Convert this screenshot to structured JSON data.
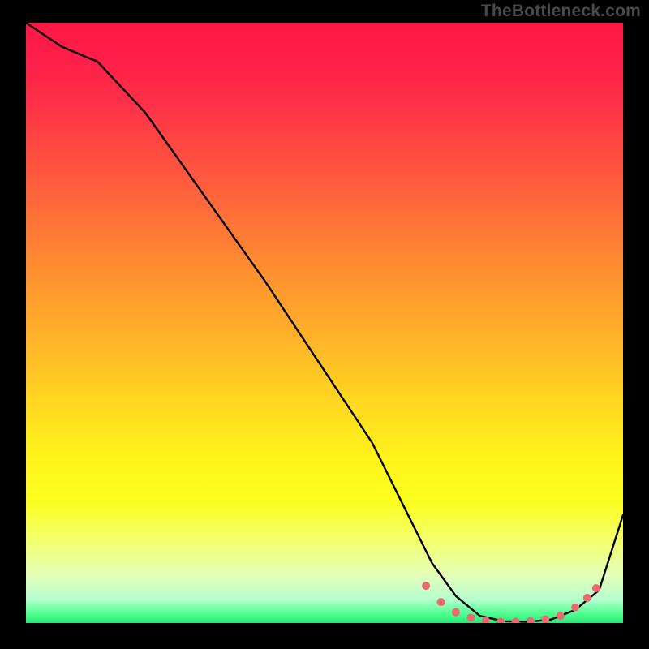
{
  "watermark": "TheBottleneck.com",
  "chart_data": {
    "type": "line",
    "title": "",
    "xlabel": "",
    "ylabel": "",
    "xlim": [
      0,
      100
    ],
    "ylim": [
      0,
      100
    ],
    "series": [
      {
        "name": "bottleneck-curve",
        "x": [
          0,
          6,
          12,
          20,
          30,
          40,
          50,
          58,
          64,
          68,
          72,
          76,
          80,
          84,
          88,
          92,
          96,
          100
        ],
        "y": [
          100,
          96,
          93.5,
          85,
          71,
          57,
          42,
          30,
          18,
          10,
          4.5,
          1.2,
          0.3,
          0.2,
          0.6,
          2.2,
          5.5,
          18
        ]
      }
    ],
    "markers": {
      "name": "flat-region-dots",
      "x": [
        67,
        69.5,
        72,
        74.5,
        77,
        79.5,
        82,
        84.5,
        87,
        89.5,
        92,
        94,
        95.5
      ],
      "y": [
        6.2,
        3.5,
        1.8,
        0.9,
        0.4,
        0.2,
        0.2,
        0.3,
        0.6,
        1.2,
        2.6,
        4.2,
        5.8
      ]
    }
  }
}
